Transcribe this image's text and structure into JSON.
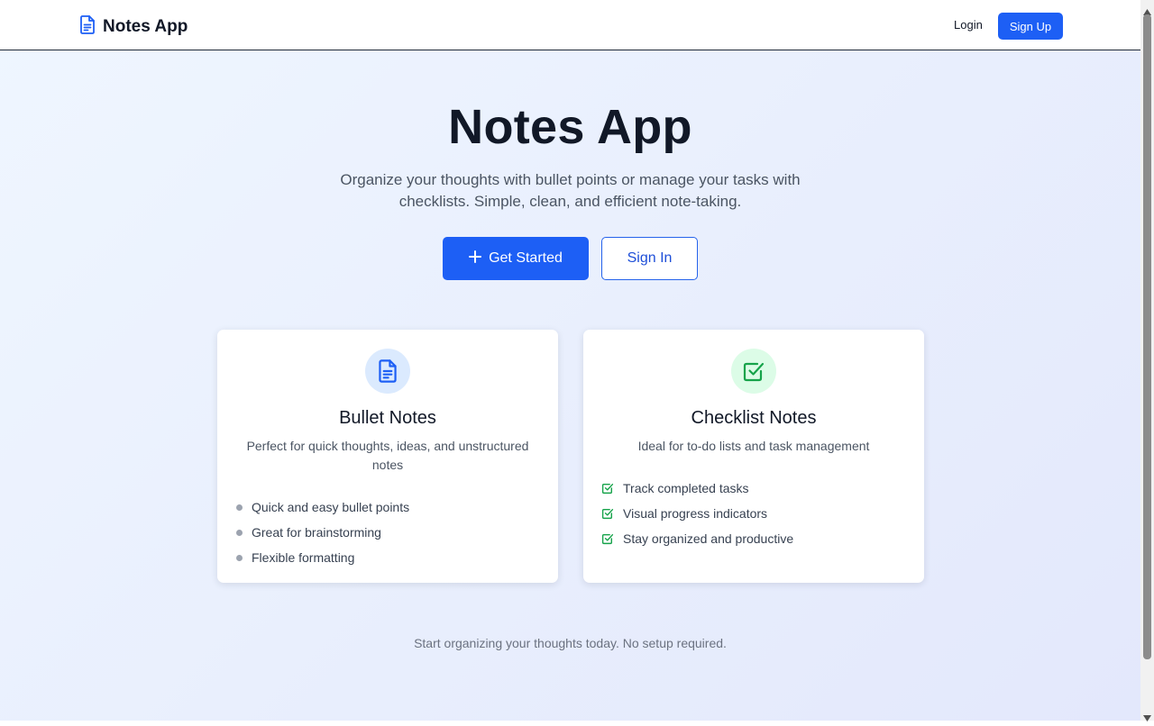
{
  "nav": {
    "brand": "Notes App",
    "login": "Login",
    "signup": "Sign Up"
  },
  "hero": {
    "title": "Notes App",
    "subtitle": "Organize your thoughts with bullet points or manage your tasks with checklists. Simple, clean, and efficient note-taking.",
    "primary_button": "Get Started",
    "secondary_button": "Sign In"
  },
  "cards": [
    {
      "icon": "document-icon",
      "title": "Bullet Notes",
      "description": "Perfect for quick thoughts, ideas, and unstructured notes",
      "features": [
        "Quick and easy bullet points",
        "Great for brainstorming",
        "Flexible formatting"
      ]
    },
    {
      "icon": "checkbox-icon",
      "title": "Checklist Notes",
      "description": "Ideal for to-do lists and task management",
      "features": [
        "Track completed tasks",
        "Visual progress indicators",
        "Stay organized and productive"
      ]
    }
  ],
  "footer": {
    "text": "Start organizing your thoughts today. No setup required."
  },
  "colors": {
    "primary": "#1d5ff5",
    "check_green": "#16a34a",
    "icon_blue": "#1d5ff5",
    "heading": "#111827"
  }
}
